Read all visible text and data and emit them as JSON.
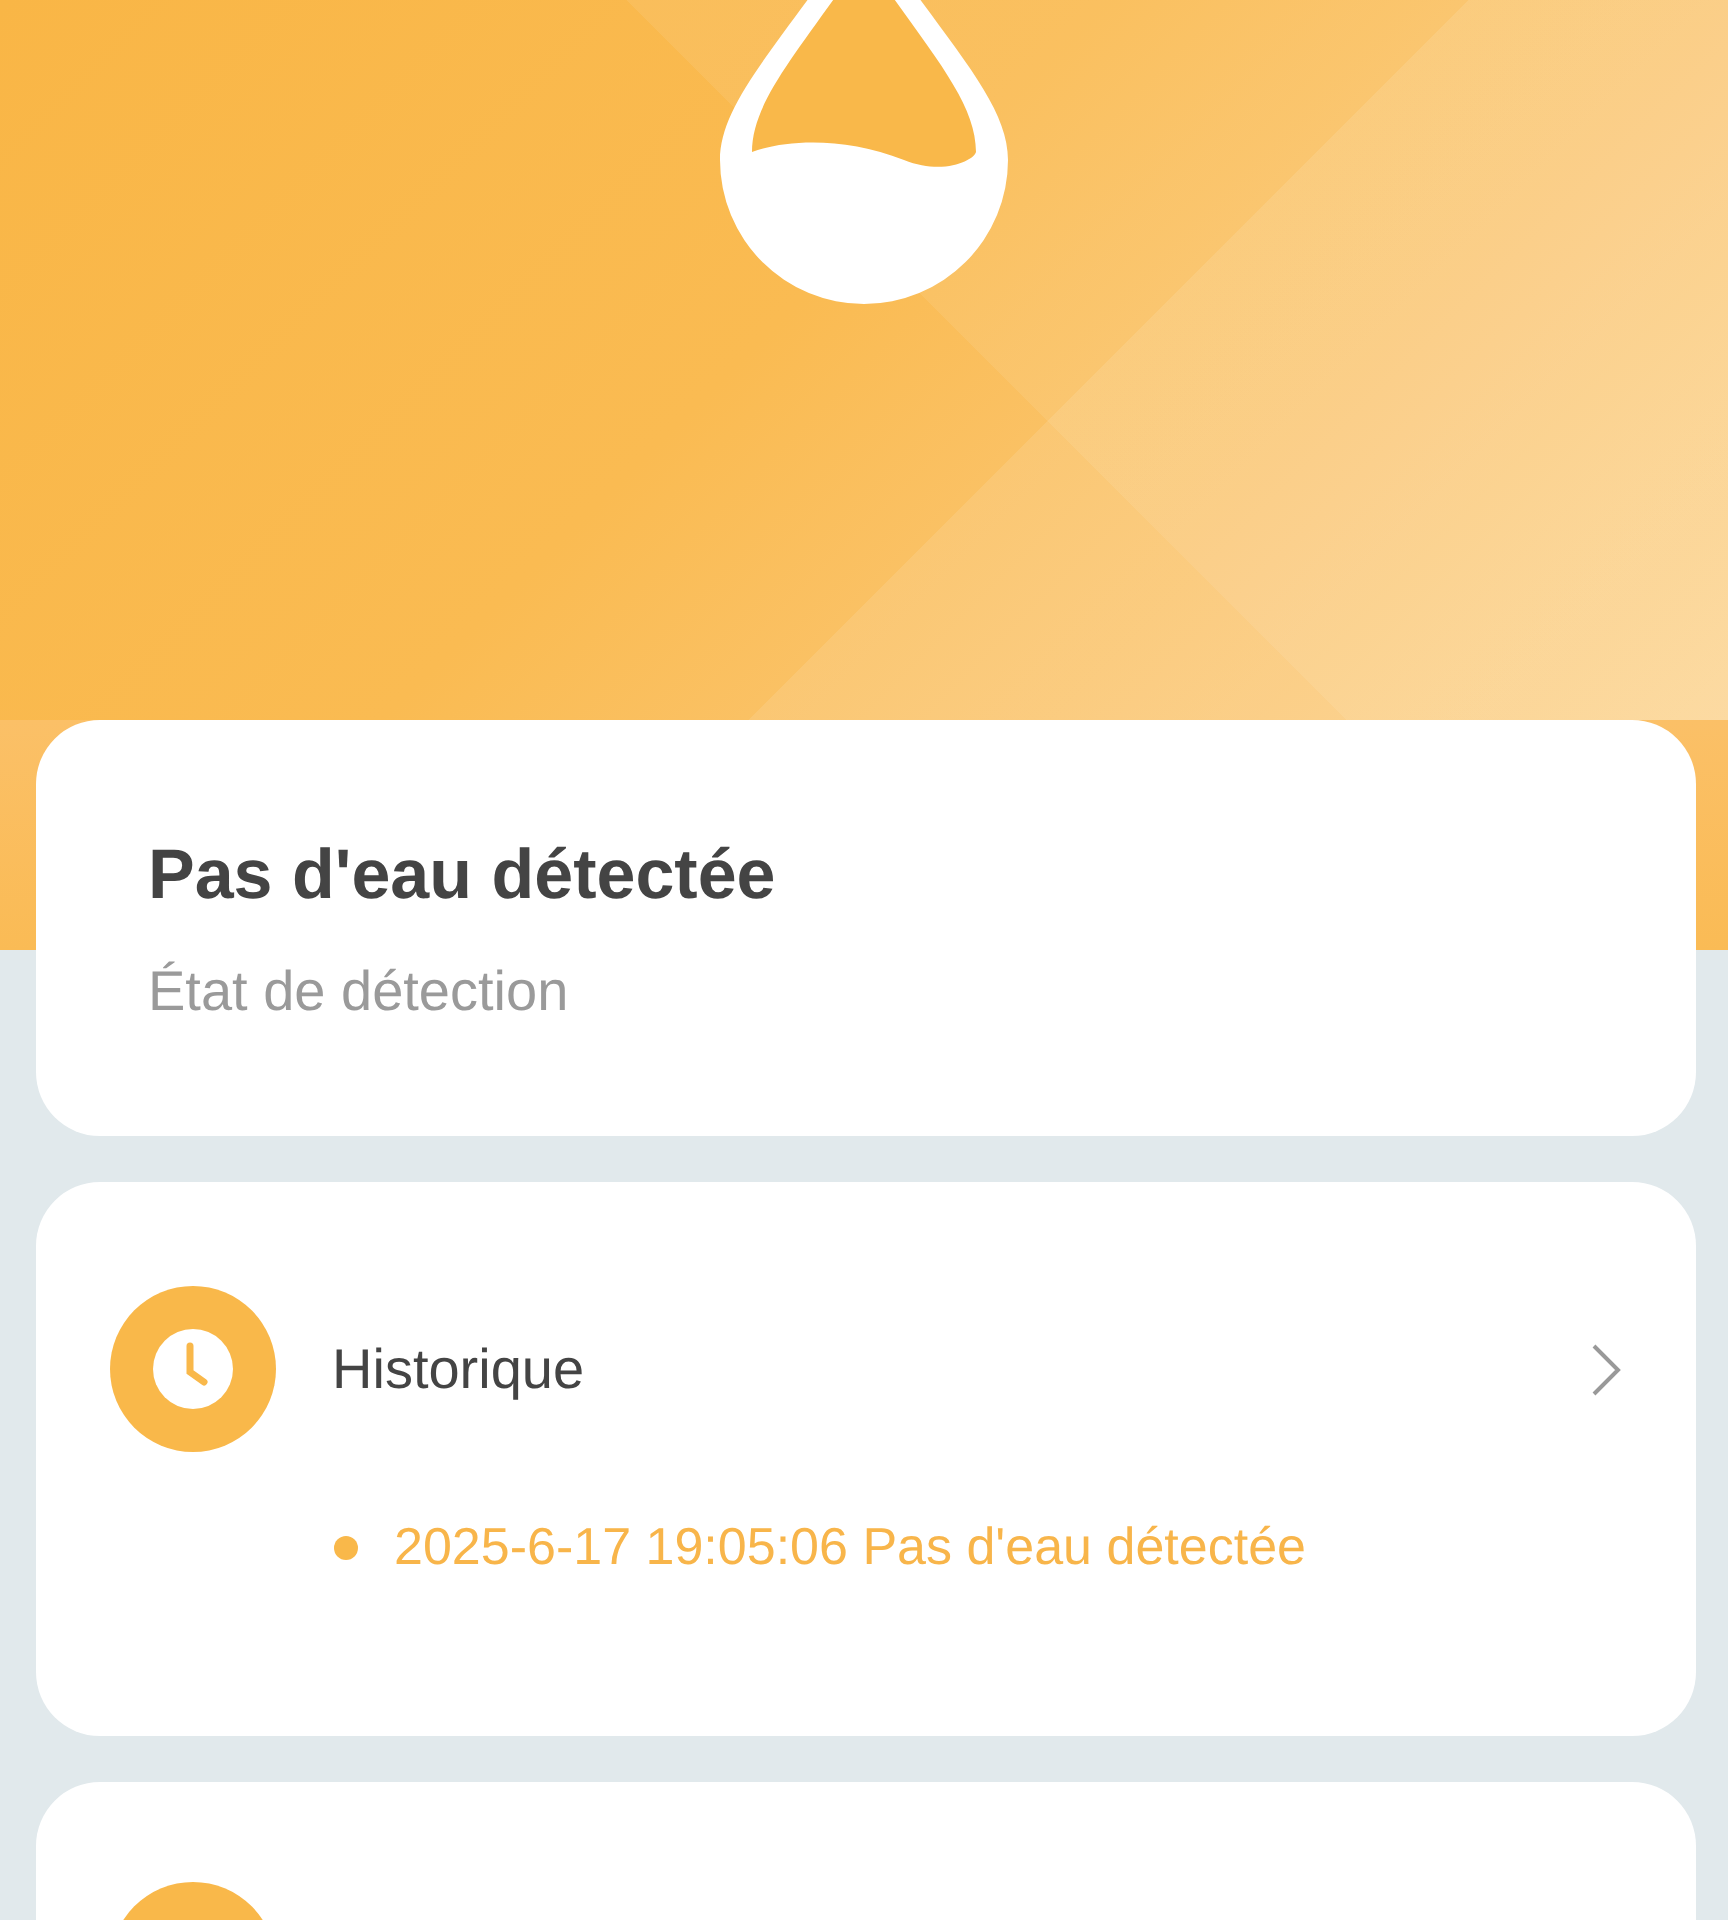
{
  "status": {
    "title": "Pas d'eau détectée",
    "subtitle": "État de détection"
  },
  "sections": [
    {
      "kind": "history",
      "title": "Historique",
      "entries": [
        "2025-6-17 19:05:06 Pas d'eau détectée"
      ]
    },
    {
      "kind": "clipped"
    }
  ]
}
